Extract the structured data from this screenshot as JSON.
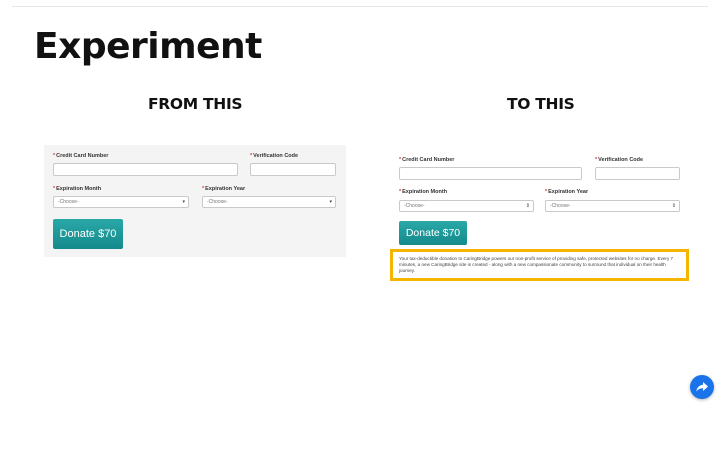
{
  "page": {
    "title": "Experiment",
    "left_heading": "FROM THIS",
    "right_heading": "TO THIS"
  },
  "form_labels": {
    "required_mark": "*",
    "credit_card_number": "Credit Card Number",
    "verification_code": "Verification Code",
    "expiration_month": "Expiration Month",
    "expiration_year": "Expiration Year"
  },
  "selects": {
    "month_value": "-Choose-",
    "year_value": "-Choose-",
    "arrow_left": "▾",
    "arrow_right": "⇕"
  },
  "buttons": {
    "donate": "Donate $70"
  },
  "note": {
    "text": "Your tax-deductible donation to CaringBridge powers our non-profit service of providing safe, protected websites for no charge. Every 7 minutes, a new CaringBridge site is created - along with a new compassionate community to surround that individual on their health journey.",
    "highlight_color": "#f5b400"
  },
  "icons": {
    "share": "share-arrow-icon"
  },
  "colors": {
    "button_teal": "#1a9a9c",
    "share_blue": "#1a73e8"
  }
}
